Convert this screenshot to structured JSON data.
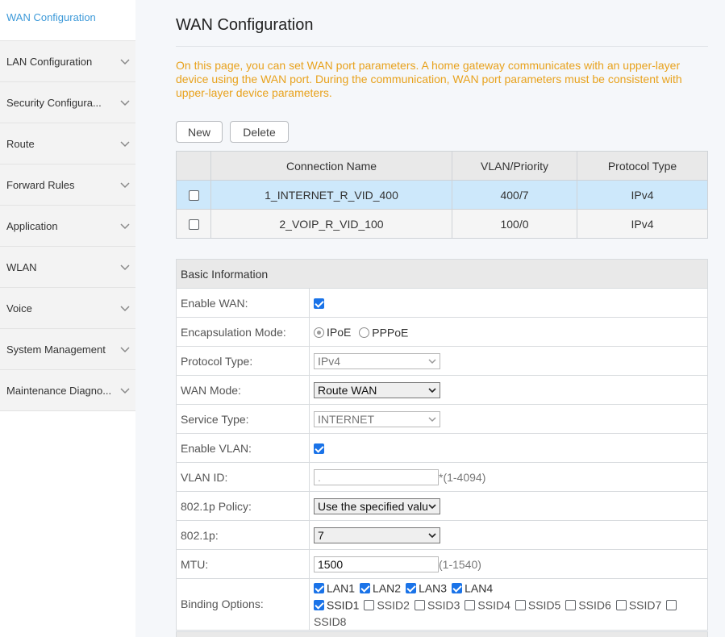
{
  "sidebar": {
    "items": [
      {
        "label": "WAN Configuration",
        "active": true
      },
      {
        "label": "LAN Configuration"
      },
      {
        "label": "Security Configura..."
      },
      {
        "label": "Route"
      },
      {
        "label": "Forward Rules"
      },
      {
        "label": "Application"
      },
      {
        "label": "WLAN"
      },
      {
        "label": "Voice"
      },
      {
        "label": "System Management"
      },
      {
        "label": "Maintenance Diagno..."
      }
    ]
  },
  "page": {
    "title": "WAN Configuration",
    "description": "On this page, you can set WAN port parameters. A home gateway communicates with an upper-layer device using the WAN port. During the communication, WAN port parameters must be consistent with upper-layer device parameters."
  },
  "toolbar": {
    "new_label": "New",
    "delete_label": "Delete"
  },
  "wan_table": {
    "headers": [
      "Connection Name",
      "VLAN/Priority",
      "Protocol Type"
    ],
    "rows": [
      {
        "name": "1_INTERNET_R_VID_400",
        "vlan": "400/7",
        "protocol": "IPv4"
      },
      {
        "name": "2_VOIP_R_VID_100",
        "vlan": "100/0",
        "protocol": "IPv4"
      }
    ]
  },
  "form": {
    "section_title": "Basic Information",
    "enable_wan_label": "Enable WAN:",
    "encap_label": "Encapsulation Mode:",
    "encap_ipoe": "IPoE",
    "encap_pppoe": "PPPoE",
    "protocol_label": "Protocol Type:",
    "protocol_value": "IPv4",
    "wan_mode_label": "WAN Mode:",
    "wan_mode_value": "Route WAN",
    "service_label": "Service Type:",
    "service_value": "INTERNET",
    "enable_vlan_label": "Enable VLAN:",
    "vlan_id_label": "VLAN ID:",
    "vlan_id_value": ".",
    "vlan_id_hint": "*(1-4094)",
    "policy_label": "802.1p Policy:",
    "policy_value": "Use the specified valu",
    "p8021_label": "802.1p:",
    "p8021_value": "7",
    "mtu_label": "MTU:",
    "mtu_value": "1500",
    "mtu_hint": "(1-1540)",
    "binding_label": "Binding Options:",
    "binding": [
      "LAN1",
      "LAN2",
      "LAN3",
      "LAN4",
      "SSID1",
      "SSID2",
      "SSID3",
      "SSID4",
      "SSID5",
      "SSID6",
      "SSID7",
      "SSID8"
    ]
  },
  "icons": {
    "chevron": "chevron-down-icon",
    "dropdown": "dropdown-arrow-icon"
  }
}
